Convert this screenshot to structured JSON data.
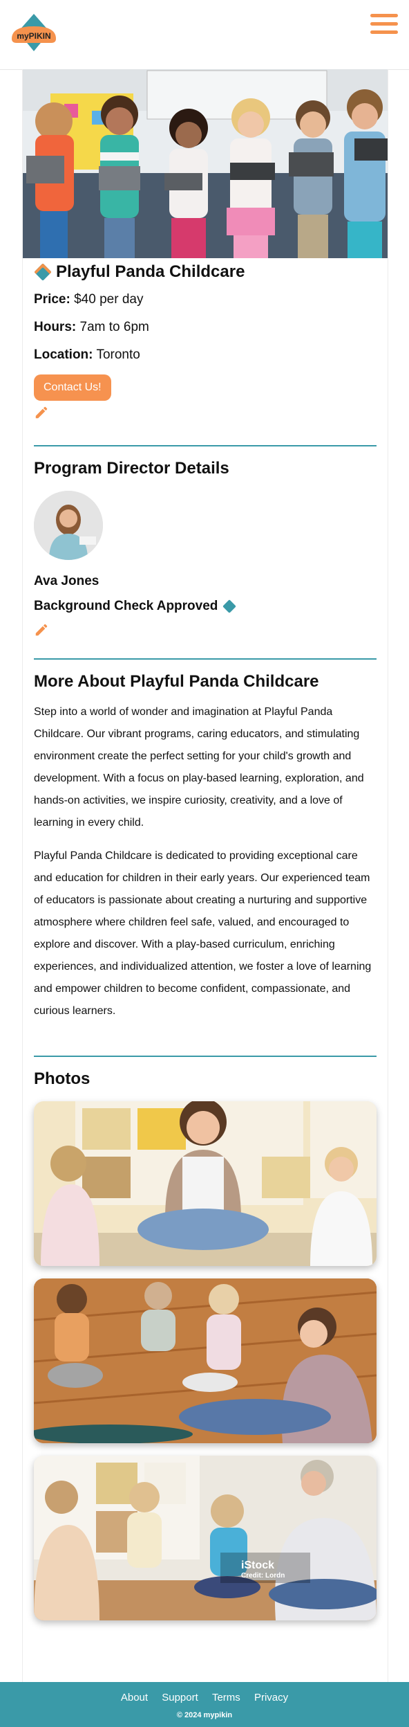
{
  "header": {
    "logo_text": "myPIKIN",
    "menu_icon": "hamburger-menu-icon",
    "brand_color": "#f5924d",
    "accent_color": "#3a9aa8"
  },
  "listing": {
    "name": "Playful Panda Childcare",
    "price_label": "Price:",
    "price": "$40 per day",
    "hours_label": "Hours:",
    "hours": "7am to 6pm",
    "location_label": "Location:",
    "location": "Toronto",
    "contact_button": "Contact Us!",
    "edit_icon": "pencil-icon"
  },
  "director": {
    "heading": "Program Director Details",
    "name": "Ava Jones",
    "background_check": "Background Check Approved",
    "edit_icon": "pencil-icon"
  },
  "about": {
    "heading": "More About Playful Panda Childcare",
    "paragraphs": [
      "Step into a world of wonder and imagination at Playful Panda Childcare. Our vibrant programs, caring educators, and stimulating environment create the perfect setting for your child's growth and development. With a focus on play-based learning, exploration, and hands-on activities, we inspire curiosity, creativity, and a love of learning in every child.",
      "Playful Panda Childcare is dedicated to providing exceptional care and education for children in their early years. Our experienced team of educators is passionate about creating a nurturing and supportive atmosphere where children feel safe, valued, and encouraged to explore and discover. With a play-based curriculum, enriching experiences, and individualized attention, we foster a love of learning and empower children to become confident, compassionate, and curious learners."
    ]
  },
  "photos": {
    "heading": "Photos",
    "watermark": "iStock",
    "watermark_credit": "Credit: Lordn"
  },
  "footer": {
    "links": [
      "About",
      "Support",
      "Terms",
      "Privacy"
    ],
    "copyright": "© 2024 mypikin"
  }
}
